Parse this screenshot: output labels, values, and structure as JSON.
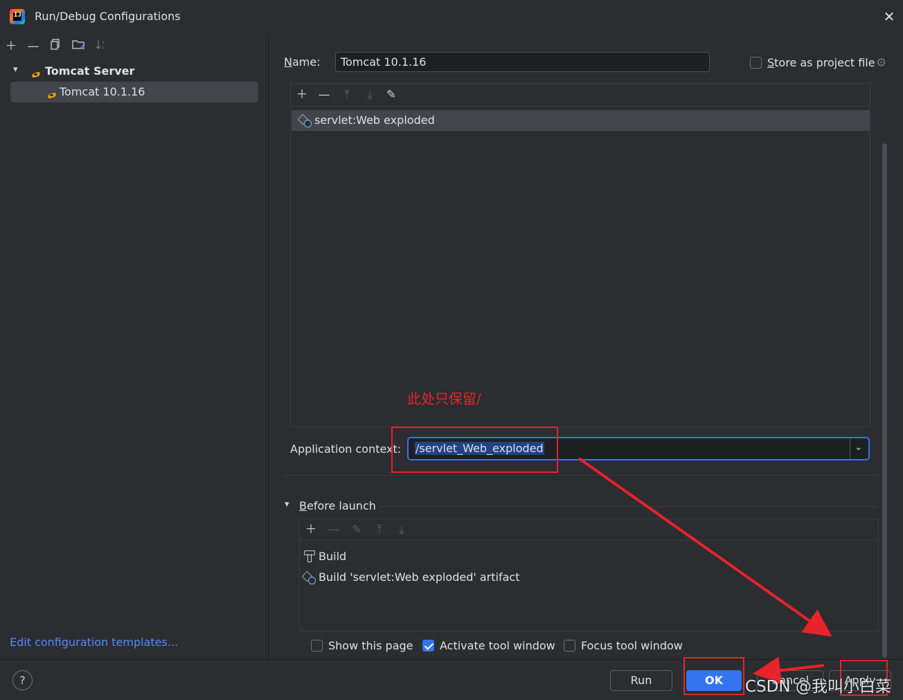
{
  "window": {
    "title": "Run/Debug Configurations",
    "close_icon": "close-icon"
  },
  "left": {
    "toolbar": [
      "add-icon",
      "remove-icon",
      "copy-icon",
      "new-folder-icon",
      "sort-icon"
    ],
    "tree": {
      "group_label": "Tomcat Server",
      "items": [
        {
          "label": "Tomcat 10.1.16",
          "selected": true
        }
      ]
    },
    "edit_templates": "Edit configuration templates..."
  },
  "right": {
    "name_label": "Name:",
    "name_value": "Tomcat 10.1.16",
    "store_label": "Store as project file",
    "store_checked": false,
    "deploy": {
      "toolbar": [
        "add-icon",
        "remove-icon",
        "move-up-icon",
        "move-down-icon",
        "edit-icon"
      ],
      "items": [
        {
          "label": "servlet:Web exploded",
          "selected": true
        }
      ]
    },
    "app_context_label": "Application context:",
    "app_context_value": "/servlet_Web_exploded",
    "before_launch": {
      "title": "Before launch",
      "toolbar": [
        "add-icon",
        "remove-icon",
        "edit-icon",
        "move-up-icon",
        "move-down-icon"
      ],
      "items": [
        {
          "icon": "hammer-icon",
          "label": "Build"
        },
        {
          "icon": "artifact-icon",
          "label": "Build 'servlet:Web exploded' artifact"
        }
      ]
    },
    "options": [
      {
        "label": "Show this page",
        "checked": false
      },
      {
        "label": "Activate tool window",
        "checked": true
      },
      {
        "label": "Focus tool window",
        "checked": false
      }
    ]
  },
  "footer": {
    "help": "?",
    "run": "Run",
    "ok": "OK",
    "cancel": "Cancel",
    "apply": "Apply"
  },
  "annotation": {
    "note": "此处只保留/",
    "color": "#e8232a"
  },
  "watermark": "CSDN @我叫小白菜",
  "colors": {
    "accent": "#3574f0",
    "link": "#548af7",
    "background": "#2b2d30",
    "field": "#1e1f22"
  }
}
